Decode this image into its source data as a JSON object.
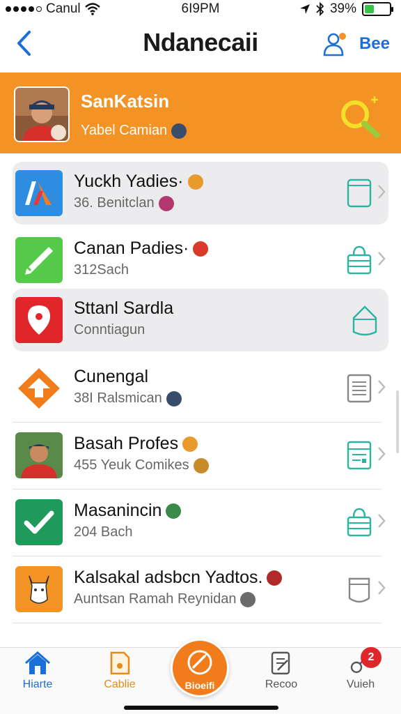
{
  "status_bar": {
    "carrier": "Canul",
    "time": "6I9PM",
    "battery_text": "39%",
    "battery_level": 0.39
  },
  "nav": {
    "title": "Ndanecaii",
    "right_label": "Bee"
  },
  "profile": {
    "name": "SanKatsin",
    "subtitle": "Yabel Camian"
  },
  "list": [
    {
      "title": "Yuckh Yadies·",
      "subtitle": "36. Benitclan",
      "icon": "brand-logo-icon",
      "icon_color": "#2d8de0",
      "right_icon": "tablet-icon",
      "highlight": true,
      "chevron": true,
      "title_emoji_color": "#e89a2a",
      "sub_emoji_color": "#b4386e"
    },
    {
      "title": "Canan Padies·",
      "subtitle": "312Sach",
      "icon": "pencil-check-icon",
      "icon_color": "#55c94a",
      "right_icon": "shopping-bag-icon",
      "highlight": false,
      "chevron": true,
      "title_emoji_color": "#d93a2a",
      "sub_emoji_color": null
    },
    {
      "title": "Sttanl Sardla",
      "subtitle": "Conntiagun",
      "icon": "map-pin-icon",
      "icon_color": "#e0262a",
      "right_icon": "home-outline-icon",
      "highlight": true,
      "chevron": false,
      "title_emoji_color": null,
      "sub_emoji_color": null
    },
    {
      "title": "Cunengal",
      "subtitle": "38I Ralsmican",
      "icon": "diamond-sign-icon",
      "icon_color": "#f07c1b",
      "right_icon": "document-icon",
      "highlight": false,
      "chevron": true,
      "title_emoji_color": null,
      "sub_emoji_color": "#3a4d6a"
    },
    {
      "title": "Basah Profes",
      "subtitle": "455 Yeuk Comikes",
      "icon": "person-photo-icon",
      "icon_color": "#4a7fb0",
      "right_icon": "spreadsheet-icon",
      "highlight": false,
      "chevron": true,
      "title_emoji_color": "#e89a2a",
      "sub_emoji_color": "#c88b2a"
    },
    {
      "title": "Masanincin",
      "subtitle": "204 Bach",
      "icon": "checkmark-icon",
      "icon_color": "#1f9a5a",
      "right_icon": "shopping-bag-icon",
      "highlight": false,
      "chevron": true,
      "title_emoji_color": "#3a8a4a",
      "sub_emoji_color": null
    },
    {
      "title": "Kalsakal adsbcn Yadtos.",
      "subtitle": "Auntsan Ramah Reynidan",
      "icon": "llama-icon",
      "icon_color": "#f39325",
      "right_icon": "cup-icon",
      "highlight": false,
      "chevron": true,
      "title_emoji_color": "#b02a2a",
      "sub_emoji_color": "#6a6a6a"
    }
  ],
  "tabs": {
    "home": "Hiarte",
    "cable": "Cablie",
    "center": "Bioeifi",
    "recoo": "Recoo",
    "vuieh": "Vuieh",
    "badge_count": "2"
  },
  "colors": {
    "accent_orange": "#f39325",
    "accent_blue": "#1b6fd6",
    "badge_red": "#e0262a"
  }
}
